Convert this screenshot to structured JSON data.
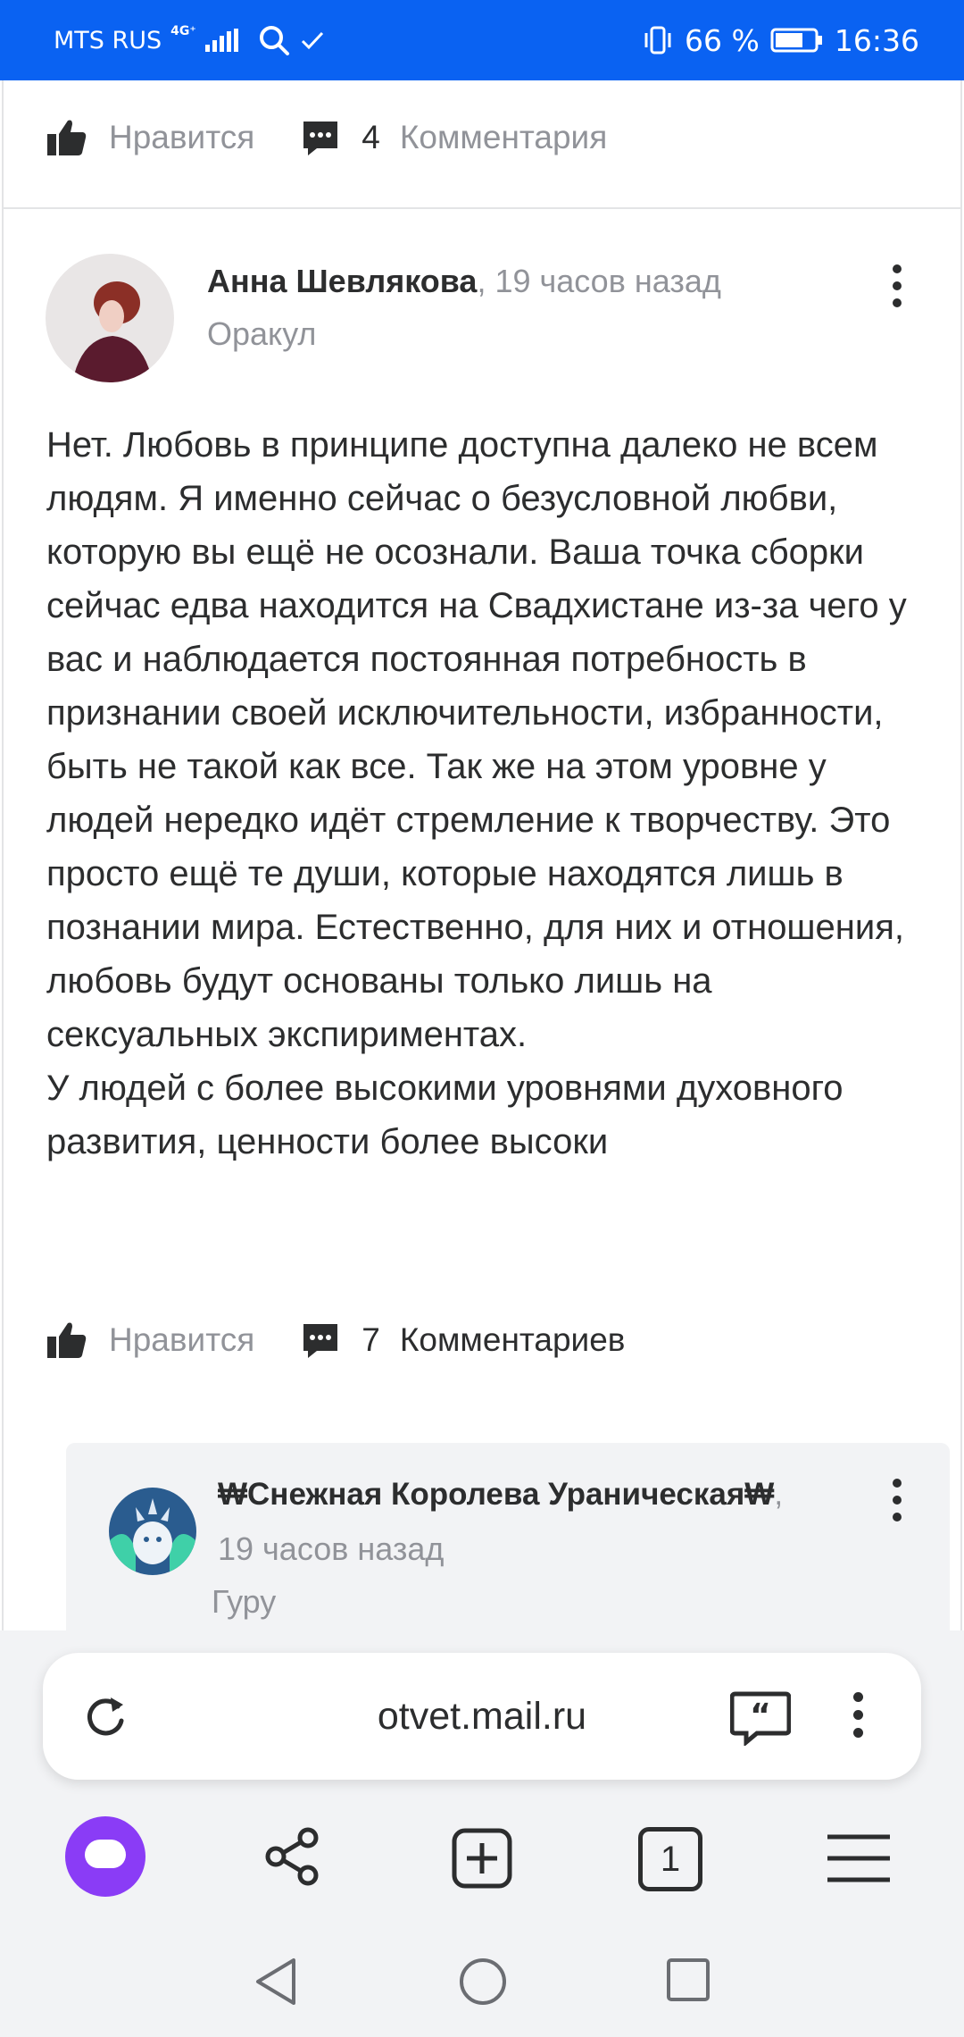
{
  "status_bar": {
    "carrier": "MTS RUS",
    "network": "4G⁺",
    "battery": "66 %",
    "time": "16:36"
  },
  "top_actions": {
    "like_label": "Нравится",
    "comment_count": "4",
    "comment_word": "Комментария"
  },
  "answer": {
    "author": "Анна Шевлякова",
    "time": ", 19 часов назад",
    "rank": "Оракул",
    "text": "Нет. Любовь в принципе доступна далеко не всем людям. Я именно сейчас о безусловной любви, которую вы ещё не осознали. Ваша точка сборки сейчас едва находится на Свадхистане из-за чего у вас и наблюдается постоянная потребность в признании своей исключительности, избранности, быть не такой как все. Так же на этом уровне у людей нередко идёт стремление к творчеству. Это просто ещё те души, которые находятся лишь в познании мира. Естественно, для них и отношения, любовь будут основаны только лишь на сексуальных экспириментах.\n   У людей с более высокими уровнями духовного развития, ценности более высоки",
    "like_label": "Нравится",
    "comment_count": "7",
    "comment_word": "Комментариев"
  },
  "comment": {
    "author": "₩Снежная Королева Ураническая₩",
    "time_prefix": ",",
    "time": "19 часов назад",
    "rank": "Гуру"
  },
  "browser": {
    "url": "otvet.mail.ru",
    "tabs_count": "1"
  },
  "colors": {
    "status_bar": "#0a62f2",
    "accent_alice": "#8a3cf6",
    "muted_text": "#919399",
    "main_text": "#2c2d2e"
  }
}
